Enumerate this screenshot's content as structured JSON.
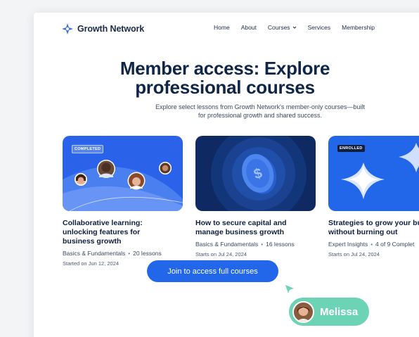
{
  "brand": {
    "name": "Growth Network"
  },
  "nav": {
    "items": [
      {
        "label": "Home"
      },
      {
        "label": "About"
      },
      {
        "label": "Courses",
        "has_dropdown": true
      },
      {
        "label": "Services"
      },
      {
        "label": "Membership"
      }
    ]
  },
  "hero": {
    "title_line1": "Member access: Explore",
    "title_line2": "professional courses",
    "subtitle_line1": "Explore select lessons from Growth Network's member-only courses—built",
    "subtitle_line2": "for professional growth and shared success."
  },
  "cards": [
    {
      "badge": "COMPLETED",
      "title_line1": "Collaborative learning:",
      "title_line2": "unlocking features for",
      "title_line3": "business growth",
      "category": "Basics & Fundamentals",
      "count": "20 lessons",
      "date": "Started on Jun 12, 2024"
    },
    {
      "badge": "",
      "title_line1": "How to secure capital and",
      "title_line2": "manage business growth",
      "category": "Basics & Fundamentals",
      "count": "16 lessons",
      "date": "Starts on Jul 24, 2024"
    },
    {
      "badge": "ENROLLED",
      "title_line1": "Strategies to grow your bu",
      "title_line2": "without burning out",
      "category": "Expert Insights",
      "count": "4 of 9 Complet",
      "date": "Starts on Jul 24, 2024"
    }
  ],
  "cta": {
    "label": "Join to access full courses"
  },
  "cursor_tag": {
    "name": "Melissa"
  },
  "colors": {
    "primary": "#2266ea",
    "navy": "#0f1f3d",
    "tag_green": "#6cd4b4"
  }
}
